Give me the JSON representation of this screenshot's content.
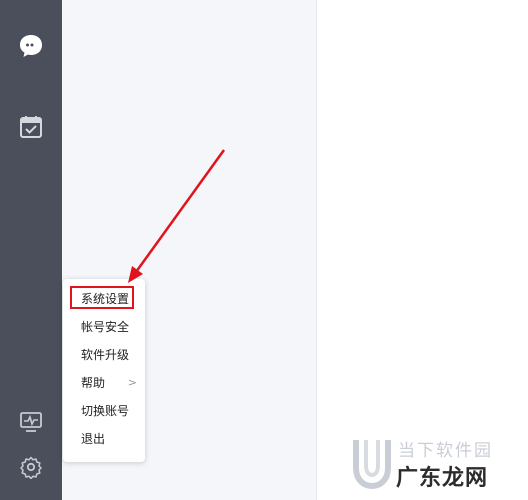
{
  "sidebar": {
    "icons": [
      "chat-icon",
      "calendar-check-icon",
      "monitor-icon",
      "gear-icon"
    ]
  },
  "menu": {
    "items": [
      {
        "label": "系统设置"
      },
      {
        "label": "帐号安全"
      },
      {
        "label": "软件升级"
      },
      {
        "label": "帮助",
        "submenu": true
      },
      {
        "label": "切换账号"
      },
      {
        "label": "退出"
      }
    ],
    "highlighted_item": "系统设置"
  },
  "watermark": {
    "top_text": "当下软件园",
    "bottom_text": "广东龙网"
  },
  "colors": {
    "sidebar": "#4a4f5b",
    "panel": "#f4f6fa",
    "highlight": "#e0141c"
  }
}
